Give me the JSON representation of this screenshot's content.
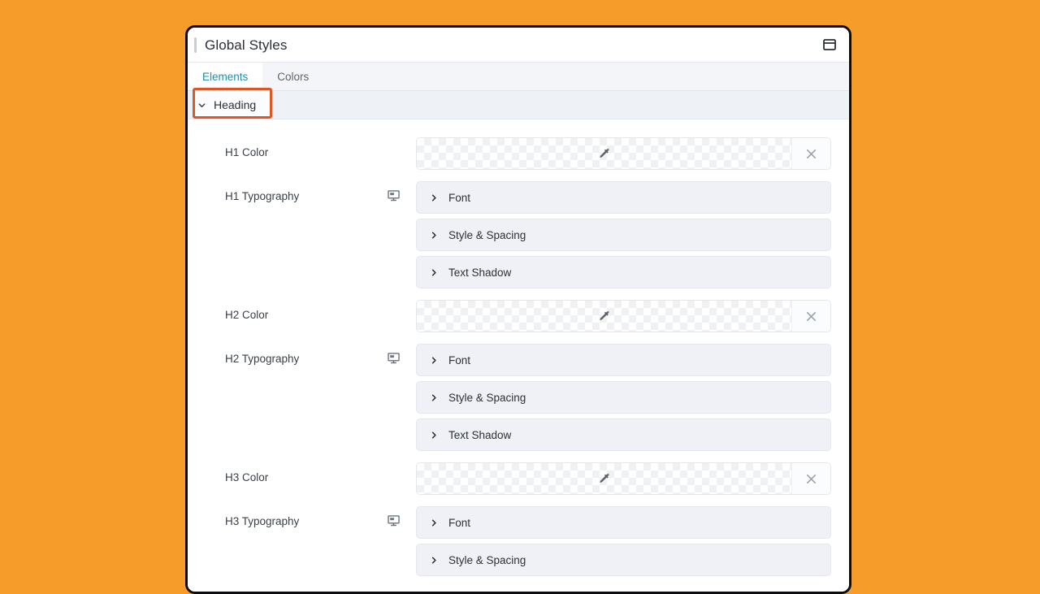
{
  "window": {
    "title": "Global Styles",
    "panel_icon": "window-panel-icon"
  },
  "tabs": [
    {
      "label": "Elements",
      "active": true
    },
    {
      "label": "Colors",
      "active": false
    }
  ],
  "section": {
    "label": "Heading",
    "expanded": true,
    "highlighted": true,
    "highlight_color": "#de5626"
  },
  "colors": {
    "accent_tab": "#1f8fa8",
    "annotation": "#de5626",
    "page_background": "#f59c2b",
    "window_border": "#0d0d0f",
    "section_header_bg": "#eef1f6",
    "accordion_bg": "#eff1f6"
  },
  "rows": [
    {
      "label": "H1 Color",
      "type": "color",
      "value": "",
      "transparent": true,
      "icons": {
        "picker": "eyedropper-icon",
        "clear": "close-icon"
      }
    },
    {
      "label": "H1 Typography",
      "type": "accordion",
      "device_icon": "desktop-icon",
      "items": [
        "Font",
        "Style & Spacing",
        "Text Shadow"
      ]
    },
    {
      "label": "H2 Color",
      "type": "color",
      "value": "",
      "transparent": true,
      "icons": {
        "picker": "eyedropper-icon",
        "clear": "close-icon"
      }
    },
    {
      "label": "H2 Typography",
      "type": "accordion",
      "device_icon": "desktop-icon",
      "items": [
        "Font",
        "Style & Spacing",
        "Text Shadow"
      ]
    },
    {
      "label": "H3 Color",
      "type": "color",
      "value": "",
      "transparent": true,
      "icons": {
        "picker": "eyedropper-icon",
        "clear": "close-icon"
      }
    },
    {
      "label": "H3 Typography",
      "type": "accordion",
      "device_icon": "desktop-icon",
      "items": [
        "Font",
        "Style & Spacing"
      ]
    }
  ]
}
